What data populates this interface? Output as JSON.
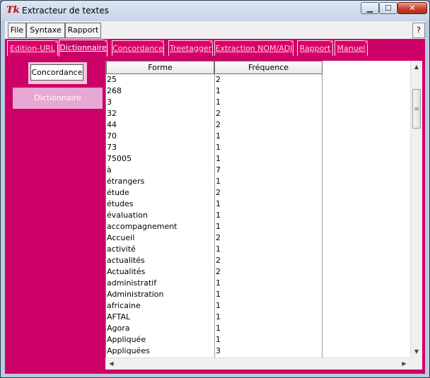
{
  "window": {
    "title": "Extracteur de textes",
    "app_icon": "tk-icon",
    "minimize_label": "▁",
    "maximize_label": "☐",
    "close_label": "✕"
  },
  "menubar": {
    "file": "File",
    "syntaxe": "Syntaxe",
    "rapport": "Rapport",
    "help": "?"
  },
  "tabs": [
    {
      "label": "Edition-URL",
      "active": false
    },
    {
      "label": "Dictionnaire",
      "active": true
    },
    {
      "label": "Concordance",
      "active": false
    },
    {
      "label": "Treetagger",
      "active": false
    },
    {
      "label": "Extraction NOM/ADJ",
      "active": false
    },
    {
      "label": "Rapport",
      "active": false
    },
    {
      "label": "Manuel",
      "active": false
    }
  ],
  "sidebar": {
    "concordance_button": "Concordance",
    "dictionnaire_button": "Dictionnaire"
  },
  "table": {
    "columns": [
      "Forme",
      "Fréquence"
    ],
    "rows": [
      [
        "25",
        "2"
      ],
      [
        "268",
        "1"
      ],
      [
        "3",
        "1"
      ],
      [
        "32",
        "2"
      ],
      [
        "44",
        "2"
      ],
      [
        "70",
        "1"
      ],
      [
        "73",
        "1"
      ],
      [
        "75005",
        "1"
      ],
      [
        "à",
        "7"
      ],
      [
        "étrangers",
        "1"
      ],
      [
        "étude",
        "2"
      ],
      [
        "études",
        "1"
      ],
      [
        "évaluation",
        "1"
      ],
      [
        "accompagnement",
        "1"
      ],
      [
        "Accueil",
        "2"
      ],
      [
        "activité",
        "1"
      ],
      [
        "actualités",
        "2"
      ],
      [
        "Actualités",
        "2"
      ],
      [
        "administratif",
        "1"
      ],
      [
        "Administration",
        "1"
      ],
      [
        "africaine",
        "1"
      ],
      [
        "AFTAL",
        "1"
      ],
      [
        "Agora",
        "1"
      ],
      [
        "Appliquée",
        "1"
      ],
      [
        "Appliquées",
        "3"
      ]
    ]
  },
  "scrollbars": {
    "up": "▲",
    "down": "▼",
    "left": "◀",
    "right": "▶",
    "grip": "≡"
  },
  "colors": {
    "accent": "#cc0066",
    "sidebar_selected": "#e7a8d3"
  }
}
